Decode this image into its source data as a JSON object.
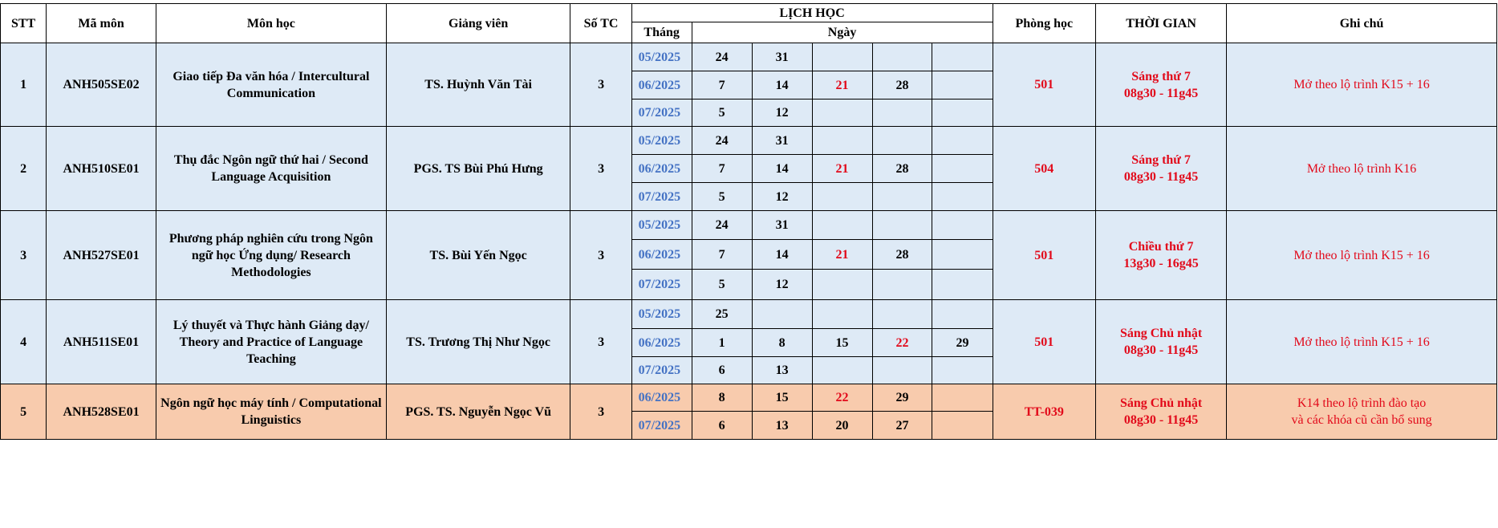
{
  "headers": {
    "stt": "STT",
    "ma_mon": "Mã môn",
    "mon_hoc": "Môn học",
    "giang_vien": "Giảng viên",
    "so_tc": "Số TC",
    "lich_hoc": "LỊCH HỌC",
    "thang": "Tháng",
    "ngay": "Ngày",
    "phong_hoc": "Phòng học",
    "thoi_gian": "THỜI GIAN",
    "ghi_chu": "Ghi chú"
  },
  "courses": [
    {
      "stt": "1",
      "ma_mon": "ANH505SE02",
      "mon_hoc": "Giao tiếp Đa văn hóa / Intercultural Communication",
      "giang_vien": "TS. Huỳnh Văn Tài",
      "so_tc": "3",
      "phong_hoc": "501",
      "thoi_gian_1": "Sáng thứ 7",
      "thoi_gian_2": "08g30 - 11g45",
      "ghi_chu_1": "Mở theo lộ trình K15 + 16",
      "ghi_chu_2": "",
      "schedule": [
        {
          "month": "05/2025",
          "days": [
            "24",
            "31",
            "",
            "",
            ""
          ]
        },
        {
          "month": "06/2025",
          "days": [
            "7",
            "14",
            "21",
            "28",
            ""
          ]
        },
        {
          "month": "07/2025",
          "days": [
            "5",
            "12",
            "",
            "",
            ""
          ]
        }
      ]
    },
    {
      "stt": "2",
      "ma_mon": "ANH510SE01",
      "mon_hoc": "Thụ đắc Ngôn ngữ thứ hai / Second Language Acquisition",
      "giang_vien": "PGS. TS Bùi Phú Hưng",
      "so_tc": "3",
      "phong_hoc": "504",
      "thoi_gian_1": "Sáng thứ 7",
      "thoi_gian_2": "08g30 - 11g45",
      "ghi_chu_1": "Mở theo lộ trình K16",
      "ghi_chu_2": "",
      "schedule": [
        {
          "month": "05/2025",
          "days": [
            "24",
            "31",
            "",
            "",
            ""
          ]
        },
        {
          "month": "06/2025",
          "days": [
            "7",
            "14",
            "21",
            "28",
            ""
          ]
        },
        {
          "month": "07/2025",
          "days": [
            "5",
            "12",
            "",
            "",
            ""
          ]
        }
      ]
    },
    {
      "stt": "3",
      "ma_mon": "ANH527SE01",
      "mon_hoc": "Phương pháp nghiên cứu trong Ngôn ngữ học Ứng dụng/ Research Methodologies",
      "giang_vien": "TS. Bùi Yến Ngọc",
      "so_tc": "3",
      "phong_hoc": "501",
      "thoi_gian_1": "Chiều thứ 7",
      "thoi_gian_2": "13g30 - 16g45",
      "ghi_chu_1": "Mở theo lộ trình K15 + 16",
      "ghi_chu_2": "",
      "schedule": [
        {
          "month": "05/2025",
          "days": [
            "24",
            "31",
            "",
            "",
            ""
          ]
        },
        {
          "month": "06/2025",
          "days": [
            "7",
            "14",
            "21",
            "28",
            ""
          ]
        },
        {
          "month": "07/2025",
          "days": [
            "5",
            "12",
            "",
            "",
            ""
          ]
        }
      ]
    },
    {
      "stt": "4",
      "ma_mon": "ANH511SE01",
      "mon_hoc": "Lý thuyết và Thực hành Giảng dạy/ Theory and Practice of Language Teaching",
      "giang_vien": "TS. Trương Thị Như Ngọc",
      "so_tc": "3",
      "phong_hoc": "501",
      "thoi_gian_1": "Sáng Chủ nhật",
      "thoi_gian_2": "08g30 - 11g45",
      "ghi_chu_1": "Mở theo lộ trình K15 + 16",
      "ghi_chu_2": "",
      "schedule": [
        {
          "month": "05/2025",
          "days": [
            "25",
            "",
            "",
            "",
            ""
          ]
        },
        {
          "month": "06/2025",
          "days": [
            "1",
            "8",
            "15",
            "22",
            "29"
          ]
        },
        {
          "month": "07/2025",
          "days": [
            "6",
            "13",
            "",
            "",
            ""
          ]
        }
      ]
    },
    {
      "stt": "5",
      "ma_mon": "ANH528SE01",
      "mon_hoc": "Ngôn ngữ học máy tính / Computational Linguistics",
      "giang_vien": "PGS. TS. Nguyễn Ngọc Vũ",
      "so_tc": "3",
      "phong_hoc": "TT-039",
      "thoi_gian_1": "Sáng Chủ nhật",
      "thoi_gian_2": "08g30 - 11g45",
      "ghi_chu_1": "K14 theo lộ trình đào tạo",
      "ghi_chu_2": "và các khóa cũ cần bổ sung",
      "schedule": [
        {
          "month": "06/2025",
          "days": [
            "8",
            "15",
            "22",
            "29",
            ""
          ]
        },
        {
          "month": "07/2025",
          "days": [
            "6",
            "13",
            "20",
            "27",
            ""
          ]
        }
      ]
    }
  ],
  "colors": {
    "row_blue": "#deeaf6",
    "row_orange": "#f8cbad",
    "month_blue": "#4472c4",
    "highlight_red": "#e2091a"
  }
}
